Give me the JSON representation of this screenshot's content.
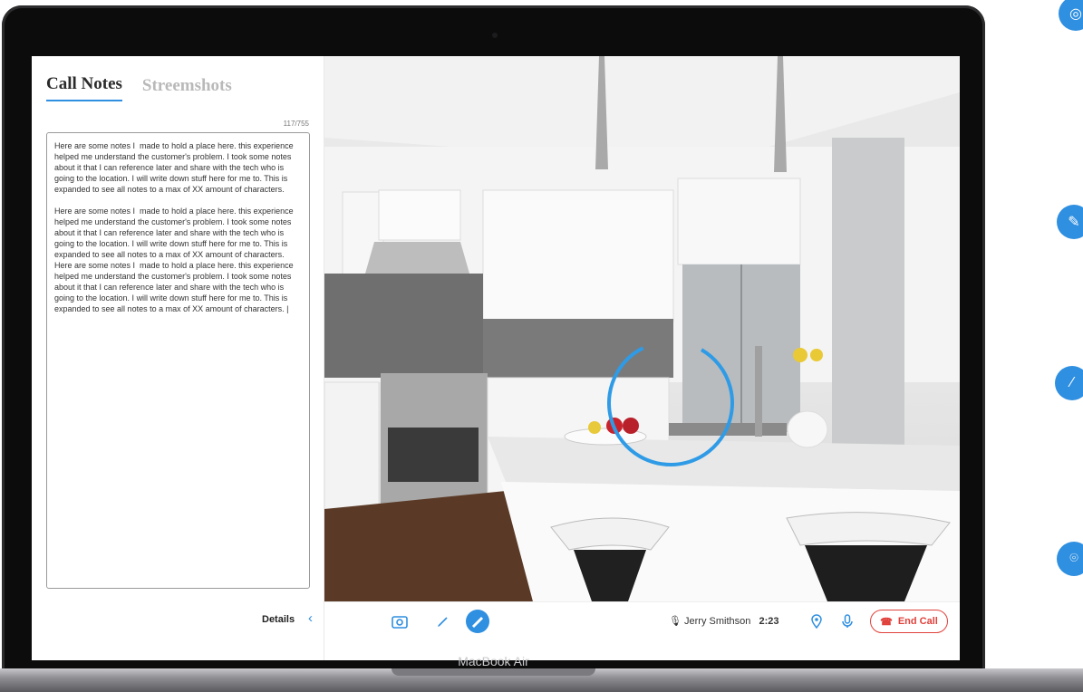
{
  "tabs": [
    "Call Notes",
    "Streemshots"
  ],
  "counter": "117/755",
  "notes_text": "Here are some notes I  made to hold a place here. this experience helped me understand the customer's problem. I took some notes about it that I can reference later and share with the tech who is going to the location. I will write down stuff here for me to. This is expanded to see all notes to a max of XX amount of characters.\n\nHere are some notes I  made to hold a place here. this experience helped me understand the customer's problem. I took some notes about it that I can reference later and share with the tech who is going to the location. I will write down stuff here for me to. This is expanded to see all notes to a max of XX amount of characters. Here are some notes I  made to hold a place here. this experience helped me understand the customer's problem. I took some notes about it that I can reference later and share with the tech who is going to the location. I will write down stuff here for me to. This is expanded to see all notes to a max of XX amount of characters. |",
  "details_label": "Details",
  "caller_name": "Jerry Smithson",
  "call_time": "2:23",
  "end_call_label": "End Call",
  "device_label": "MacBook Air",
  "colors": {
    "accent": "#2f8fe0",
    "danger": "#e0413b"
  },
  "icons": {
    "toolbar": [
      "camera-icon",
      "pen-icon",
      "draw-icon"
    ],
    "status": [
      "mic-icon",
      "location-icon",
      "mic-icon",
      "phone-icon"
    ],
    "side": [
      "camera-icon",
      "draw-icon",
      "pen-icon",
      "location-icon"
    ]
  }
}
